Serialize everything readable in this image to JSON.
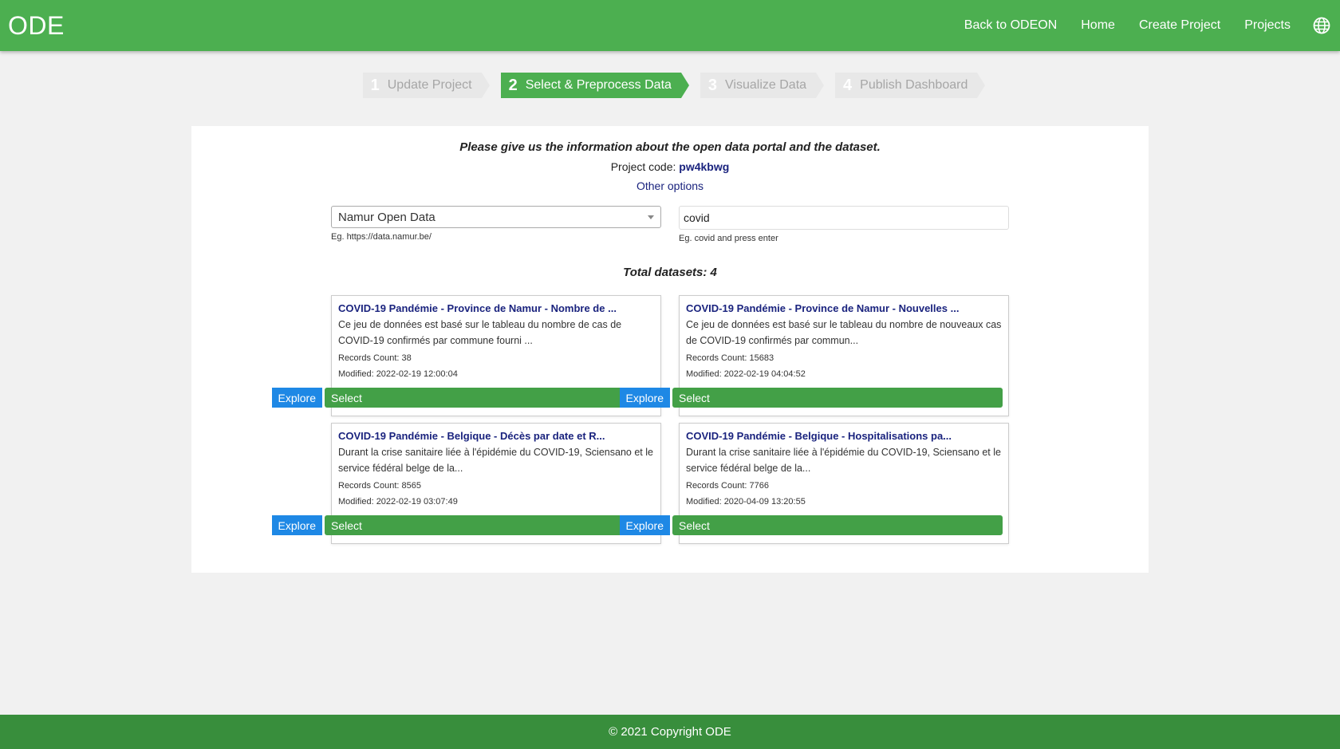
{
  "header": {
    "brand": "ODE",
    "nav": [
      "Back to ODEON",
      "Home",
      "Create Project",
      "Projects"
    ],
    "language_icon": "globe-icon"
  },
  "stepper": [
    {
      "num": "1",
      "label": "Update Project",
      "active": false
    },
    {
      "num": "2",
      "label": "Select & Preprocess Data",
      "active": true
    },
    {
      "num": "3",
      "label": "Visualize Data",
      "active": false
    },
    {
      "num": "4",
      "label": "Publish Dashboard",
      "active": false
    }
  ],
  "intro": {
    "question": "Please give us the information about the open data portal and the dataset.",
    "project_code_label": "Project code:",
    "project_code": "pw4kbwg",
    "other_options": "Other options"
  },
  "portal": {
    "selected": "Namur Open Data",
    "hint": "Eg. https://data.namur.be/"
  },
  "search": {
    "value": "covid",
    "hint": "Eg. covid and press enter"
  },
  "total_label": "Total datasets: 4",
  "buttons": {
    "explore": "Explore",
    "select": "Select"
  },
  "datasets": [
    {
      "title": "COVID-19 Pandémie - Province de Namur - Nombre de ...",
      "description": "Ce jeu de données est basé sur le tableau du nombre de cas de COVID-19 confirmés par commune fourni ...",
      "records": "Records Count: 38",
      "modified": "Modified: 2022-02-19 12:00:04"
    },
    {
      "title": "COVID-19 Pandémie - Province de Namur - Nouvelles ...",
      "description": "Ce jeu de données est basé sur le tableau du nombre de nouveaux cas de COVID-19 confirmés par commun...",
      "records": "Records Count: 15683",
      "modified": "Modified: 2022-02-19 04:04:52"
    },
    {
      "title": "COVID-19 Pandémie - Belgique - Décès par date et R...",
      "description": "Durant la crise sanitaire liée à l'épidémie du COVID-19, Sciensano et le service fédéral belge de la...",
      "records": "Records Count: 8565",
      "modified": "Modified: 2022-02-19 03:07:49"
    },
    {
      "title": "COVID-19 Pandémie - Belgique - Hospitalisations pa...",
      "description": "Durant la crise sanitaire liée à l'épidémie du COVID-19, Sciensano et le service fédéral belge de la...",
      "records": "Records Count: 7766",
      "modified": "Modified: 2020-04-09 13:20:55"
    }
  ],
  "footer": "© 2021 Copyright ODE",
  "colors": {
    "header": "#4caf50",
    "footer": "#388e3c",
    "explore_button": "#1e88e5",
    "select_button": "#43a047",
    "link": "#1a237e"
  }
}
